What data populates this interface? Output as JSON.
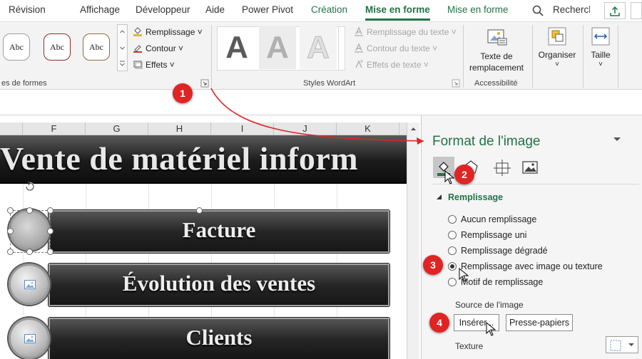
{
  "tabs": [
    {
      "label": "Révision"
    },
    {
      "label": "Affichage"
    },
    {
      "label": "Développeur"
    },
    {
      "label": "Aide"
    },
    {
      "label": "Power Pivot"
    },
    {
      "label": "Création"
    },
    {
      "label": "Mise en forme"
    },
    {
      "label": "Mise en forme"
    }
  ],
  "search_placeholder": "Recherché",
  "ribbon": {
    "shape_styles": {
      "thumb_label": "Abc",
      "fill_label": "Remplissage",
      "outline_label": "Contour",
      "effects_label": "Effets",
      "group_label": "es de formes"
    },
    "wordart": {
      "letter": "A",
      "fill_label": "Remplissage du texte",
      "outline_label": "Contour du texte",
      "effects_label": "Effets de texte",
      "group_label": "Styles WordArt"
    },
    "accessibility": {
      "alt_text_label_1": "Texte de",
      "alt_text_label_2": "remplacement",
      "group_label": "Accessibilité"
    },
    "arrange_label": "Organiser",
    "size_label": "Taille"
  },
  "sheet": {
    "columns": [
      "F",
      "G",
      "H",
      "I",
      "J",
      "K"
    ],
    "banner_text": "Vente de matériel inform",
    "items": [
      {
        "label": "Facture"
      },
      {
        "label": "Évolution des ventes"
      },
      {
        "label": "Clients"
      }
    ]
  },
  "pane": {
    "title": "Format de l'image",
    "section_label": "Remplissage",
    "options": [
      {
        "label": "Aucun remplissage",
        "selected": false
      },
      {
        "label": "Remplissage uni",
        "selected": false
      },
      {
        "label": "Remplissage dégradé",
        "selected": false
      },
      {
        "label": "Remplissage avec image ou texture",
        "selected": true
      },
      {
        "label": "Motif de remplissage",
        "selected": false
      }
    ],
    "source_label": "Source de l'image",
    "insert_button": "Insérer...",
    "clipboard_button": "Presse-papiers",
    "texture_label": "Texture"
  },
  "callouts": [
    "1",
    "2",
    "3",
    "4"
  ],
  "colors": {
    "accent_green": "#217346",
    "callout_red": "#e02424"
  }
}
